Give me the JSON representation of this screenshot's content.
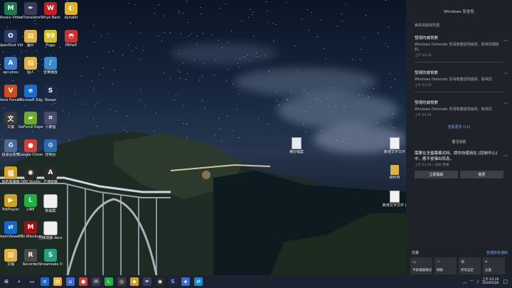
{
  "desktop": {
    "icons_col1": [
      {
        "label": "Movavi Video Edit...",
        "icon": "movavi-icon",
        "color": "#1a7a4a",
        "glyph": "M"
      },
      {
        "label": "OpenShot Video Editor",
        "icon": "openshot-icon",
        "color": "#2a3a6a",
        "glyph": "O"
      },
      {
        "label": "api-yoou",
        "icon": "app-icon",
        "color": "#3a7ad0",
        "glyph": "A"
      },
      {
        "label": "Voice Force Center",
        "icon": "shield-icon",
        "color": "#d04a1a",
        "glyph": "V"
      },
      {
        "label": "文檔",
        "icon": "document-icon",
        "color": "#3a3a3a",
        "glyph": "文"
      },
      {
        "label": "資源回收筒",
        "icon": "recycle-bin-icon",
        "color": "#4a6a9a",
        "glyph": "♻"
      },
      {
        "label": "福昕閱讀器",
        "icon": "reader-icon",
        "color": "#d8a020",
        "glyph": "福"
      },
      {
        "label": "PotPlayer",
        "icon": "potplayer-icon",
        "color": "#d0a020",
        "glyph": "▶"
      },
      {
        "label": "TeamViewer 14",
        "icon": "teamviewer-icon",
        "color": "#0e6ad0",
        "glyph": "⇄"
      },
      {
        "label": "文檔",
        "icon": "folder-icon",
        "color": "#e0b040",
        "glyph": "▤"
      }
    ],
    "icons_col2": [
      {
        "label": "nTranslator",
        "icon": "translator-icon",
        "color": "#3a3a5a",
        "glyph": "✒"
      },
      {
        "label": "圖片",
        "icon": "folder-icon",
        "color": "#e0b040",
        "glyph": "▤"
      },
      {
        "label": "個人",
        "icon": "folder-icon",
        "color": "#e0b040",
        "glyph": "▤"
      },
      {
        "label": "Microsoft Edge",
        "icon": "edge-icon",
        "color": "#1a6ad0",
        "glyph": "e"
      },
      {
        "label": "GeForce Experience",
        "icon": "nvidia-icon",
        "color": "#6ab020",
        "glyph": "▰"
      },
      {
        "label": "Google Chrome",
        "icon": "chrome-icon",
        "color": "#d04030",
        "glyph": "●"
      },
      {
        "label": "OBS Studio",
        "icon": "obs-icon",
        "color": "#2a2a2a",
        "glyph": "◉"
      },
      {
        "label": "LINE",
        "icon": "line-icon",
        "color": "#20b040",
        "glyph": "L"
      },
      {
        "label": "MSI Afterburner",
        "icon": "msi-icon",
        "color": "#a01010",
        "glyph": "M"
      },
      {
        "label": "Recorder",
        "icon": "recorder-icon",
        "color": "#4a4a4a",
        "glyph": "R"
      }
    ],
    "icons_col3": [
      {
        "label": "Wnye Back",
        "icon": "app-icon",
        "color": "#c02020",
        "glyph": "W"
      },
      {
        "label": "Fraps",
        "icon": "fraps-icon",
        "color": "#d0c020",
        "glyph": "99"
      },
      {
        "label": "音樂播放",
        "icon": "music-icon",
        "color": "#3a8ad0",
        "glyph": "♪"
      },
      {
        "label": "Steam",
        "icon": "steam-icon",
        "color": "#1a2a4a",
        "glyph": "S"
      },
      {
        "label": "小算盤",
        "icon": "calculator-icon",
        "color": "#4a4a6a",
        "glyph": "⌗"
      },
      {
        "label": "控制台",
        "icon": "control-panel-icon",
        "color": "#2a6ab0",
        "glyph": "⚙"
      },
      {
        "label": "方塊遊戲",
        "icon": "app-icon",
        "color": "#2a2a2a",
        "glyph": "A"
      },
      {
        "label": "新檔案",
        "icon": "file-icon",
        "color": "#f0f0f0",
        "glyph": ""
      },
      {
        "label": "光碟燒錄.docx",
        "icon": "word-icon",
        "color": "#f0f0f0",
        "glyph": ""
      },
      {
        "label": "Streamlabs OBS",
        "icon": "streamlabs-icon",
        "color": "#20a080",
        "glyph": "S"
      }
    ],
    "icons_col4": [
      {
        "label": "dynabit",
        "icon": "app-icon",
        "color": "#e0b020",
        "glyph": "◐"
      },
      {
        "label": "PKHeX",
        "icon": "pokeball-icon",
        "color": "#d03030",
        "glyph": "◓"
      }
    ],
    "center_file": {
      "label": "備份檔案",
      "icon": "file-icon"
    },
    "right_files": [
      {
        "label": "新增文字文件",
        "icon": "file-icon"
      },
      {
        "label": "資料夾",
        "icon": "folder-icon"
      },
      {
        "label": "新增文字文件 (2).txt",
        "icon": "file-icon"
      }
    ]
  },
  "action_center": {
    "title": "Windows 安全性",
    "section": "病毒與威脅防護",
    "notifications": [
      {
        "heading": "發現的威脅數",
        "body": "Windows Defender 防毒軟體發現威脅，取得詳細資料。",
        "time": "上午 03:19"
      },
      {
        "heading": "發現的威脅數",
        "body": "Windows Defender 防毒軟體發現威脅，取得詳",
        "time": "上午 03:19"
      },
      {
        "heading": "發現的威脅數",
        "body": "Windows Defender 防毒軟體發現威脅，取得詳",
        "time": "上午 03:19"
      }
    ],
    "see_more": "查看更多 (11)",
    "security_header": "靈活協助",
    "security_body": "需要在全螢幕模式時，請勿勿使用在 [控制中心] 中，應不會彈出訊息。",
    "security_time": "上午 03:19 • 協助 整備",
    "btn_open": "立即開啟",
    "btn_later": "變更",
    "collapse_label": "摺疊",
    "manage_label": "管理所有通知",
    "tiles": [
      {
        "label": "平板電腦模式",
        "icon": "tablet-mode-icon",
        "glyph": "▭"
      },
      {
        "label": "網路",
        "icon": "network-icon",
        "glyph": "⌔"
      },
      {
        "label": "所有設定",
        "icon": "settings-icon",
        "glyph": "⚙"
      },
      {
        "label": "位置",
        "icon": "location-icon",
        "glyph": "⌖"
      }
    ]
  },
  "taskbar": {
    "time": "上午 03:19",
    "date": "2019/5/28",
    "apps": [
      {
        "icon": "start-icon",
        "color": "#1d2230",
        "glyph": "⊞"
      },
      {
        "icon": "search-icon",
        "color": "#1d2230",
        "glyph": "⌕"
      },
      {
        "icon": "task-view-icon",
        "color": "#1d2230",
        "glyph": "▭"
      },
      {
        "icon": "edge-icon",
        "color": "#1a6ad0",
        "glyph": "e"
      },
      {
        "icon": "file-explorer-icon",
        "color": "#e0b040",
        "glyph": "▤"
      },
      {
        "icon": "store-icon",
        "color": "#3a6ad0",
        "glyph": "⌂"
      },
      {
        "icon": "chrome-icon",
        "color": "#d04030",
        "glyph": "●"
      },
      {
        "icon": "mail-icon",
        "color": "#3a3a4a",
        "glyph": "✉"
      },
      {
        "icon": "line-icon",
        "color": "#20b040",
        "glyph": "L"
      },
      {
        "icon": "app-icon",
        "color": "#3a3a3a",
        "glyph": "◎"
      },
      {
        "icon": "app-icon",
        "color": "#d0a020",
        "glyph": "◆"
      },
      {
        "icon": "pen-icon",
        "color": "#3a3a5a",
        "glyph": "✒"
      },
      {
        "icon": "obs-icon",
        "color": "#2a2a2a",
        "glyph": "◉"
      },
      {
        "icon": "steam-icon",
        "color": "#1a2a4a",
        "glyph": "S"
      },
      {
        "icon": "app-icon",
        "color": "#3a6ad0",
        "glyph": "◈"
      },
      {
        "icon": "app-icon",
        "color": "#1a8ad0",
        "glyph": "⇄"
      }
    ]
  }
}
